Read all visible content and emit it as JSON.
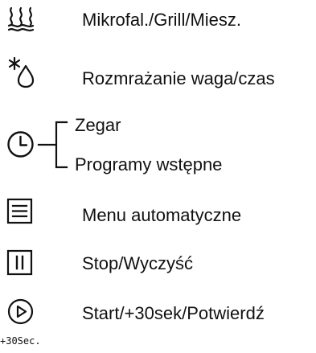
{
  "rows": [
    {
      "icon": "microwave-grill-waves-icon",
      "label": "Mikrofal./Grill/Miesz."
    },
    {
      "icon": "defrost-snowflake-drop-icon",
      "label": "Rozmrażanie waga/czas"
    },
    {
      "icon": "clock-icon",
      "label_top": "Zegar",
      "label_bottom": "Programy wstępne"
    },
    {
      "icon": "auto-menu-icon",
      "label": "Menu automatyczne"
    },
    {
      "icon": "pause-icon",
      "label": "Stop/Wyczyść"
    },
    {
      "icon": "play-icon",
      "label": "Start/+30sek/Potwierdź",
      "icon_caption": "+30Sec."
    }
  ]
}
